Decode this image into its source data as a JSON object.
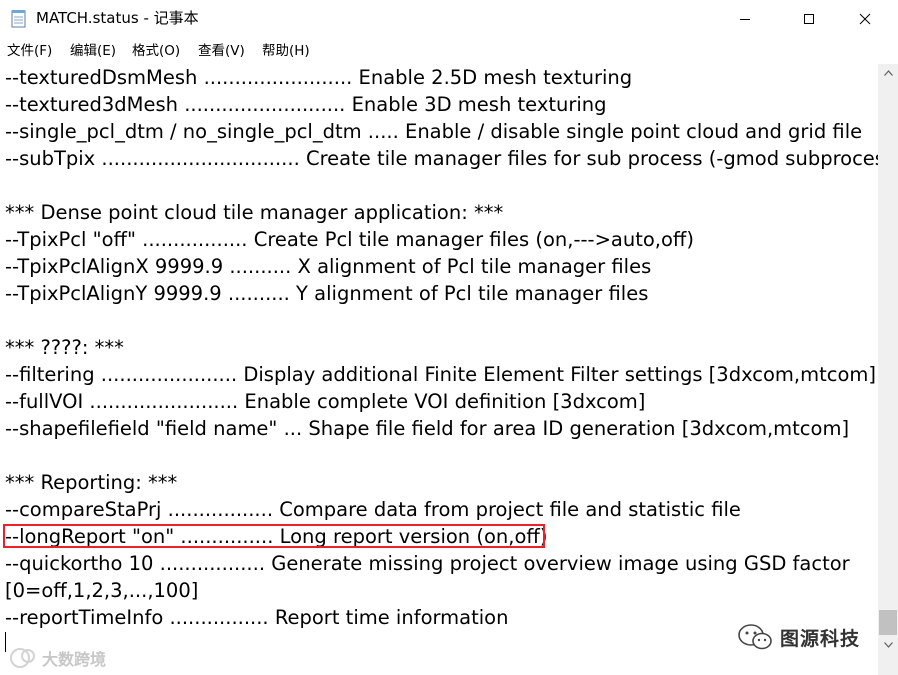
{
  "window": {
    "title": "MATCH.status - 记事本"
  },
  "menu": {
    "items": [
      "文件(F)",
      "编辑(E)",
      "格式(O)",
      "查看(V)",
      "帮助(H)"
    ]
  },
  "editor": {
    "lines": [
      "--texturedDsmMesh ........................ Enable 2.5D mesh texturing",
      "--textured3dMesh .......................... Enable 3D mesh texturing",
      "--single_pcl_dtm / no_single_pcl_dtm ..... Enable / disable single point cloud and grid file",
      "--subTpix ................................ Create tile manager files for sub process (-gmod subprocess)",
      "",
      "*** Dense point cloud tile manager application: ***",
      "--TpixPcl \"off\" ................. Create Pcl tile manager files (on,--->auto,off)",
      "--TpixPclAlignX 9999.9 .......... X alignment of Pcl tile manager files",
      "--TpixPclAlignY 9999.9 .......... Y alignment of Pcl tile manager files",
      "",
      "*** ????: ***",
      "--filtering ...................... Display additional Finite Element Filter settings [3dxcom,mtcom]",
      "--fullVOI ........................ Enable complete VOI definition [3dxcom]",
      "--shapefilefield \"field name\" ... Shape file field for area ID generation [3dxcom,mtcom]",
      "",
      "*** Reporting: ***",
      "--compareStaPrj ................. Compare data from project file and statistic file",
      "--longReport \"on\" ............... Long report version (on,off)",
      "--quickortho 10 ................. Generate missing project overview image using GSD factor",
      "[0=off,1,2,3,...,100]",
      "--reportTimeInfo ................ Report time information"
    ],
    "highlighted_line_index": 17,
    "highlight_color": "#e8212b"
  },
  "watermark": {
    "left_text": "大数跨境",
    "right_text": "图源科技"
  }
}
